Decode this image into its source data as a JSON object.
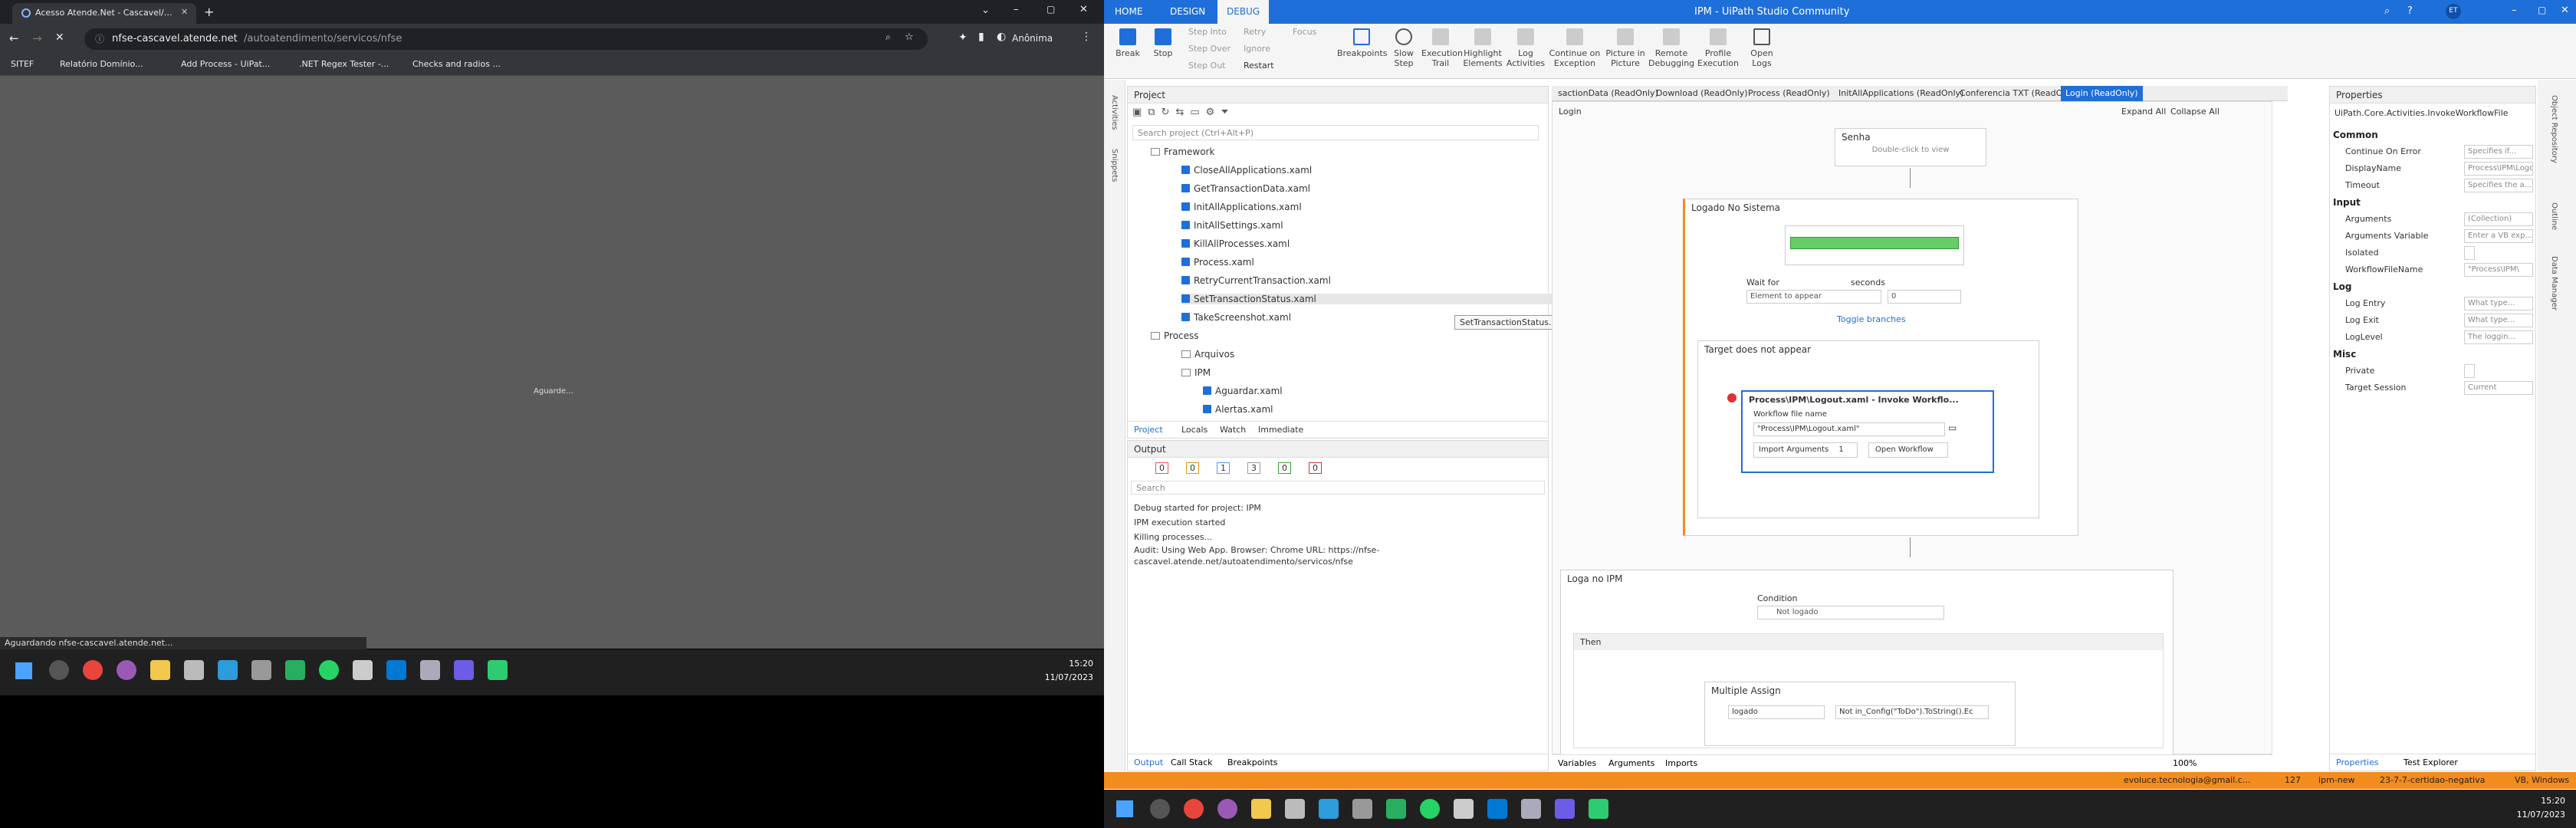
{
  "browser": {
    "tab_title": "Acesso Atende.Net - Cascavel/PR",
    "url_host": "nfse-cascavel.atende.net",
    "url_path": "/autoatendimento/servicos/nfse",
    "profile": "Anônima",
    "bookmarks": [
      "SITEF",
      "Relatório Domínio...",
      "Add Process - UiPat...",
      ".NET Regex Tester -...",
      "Checks and radios ..."
    ],
    "page_text": "Aguarde...",
    "status_text": "Aguardando nfse-cascavel.atende.net..."
  },
  "taskbar_left": {
    "time": "15:20",
    "date": "11/07/2023"
  },
  "studio": {
    "window_title": "IPM - UiPath Studio Community",
    "user_initials": "ET",
    "menu_tabs": [
      "HOME",
      "DESIGN",
      "DEBUG"
    ],
    "ribbon": {
      "break": "Break",
      "stop": "Stop",
      "step_into": "Step Into",
      "step_over": "Step Over",
      "step_out": "Step Out",
      "retry": "Retry",
      "ignore": "Ignore",
      "restart": "Restart",
      "focus": "Focus",
      "breakpoints": "Breakpoints",
      "slow_step": "Slow Step",
      "execution_trail": "Execution Trail",
      "highlight": "Highlight Elements",
      "log_activities": "Log Activities",
      "continue_on_exception": "Continue on Exception",
      "picture_in_picture": "Picture in Picture",
      "remote_debugging": "Remote Debugging",
      "profile_execution": "Profile Execution",
      "open_logs": "Open Logs"
    },
    "project": {
      "title": "Project",
      "search": "Search project (Ctrl+Alt+P)",
      "items": [
        "Framework",
        "CloseAllApplications.xaml",
        "GetTransactionData.xaml",
        "InitAllApplications.xaml",
        "InitAllSettings.xaml",
        "KillAllProcesses.xaml",
        "Process.xaml",
        "RetryCurrentTransaction.xaml",
        "SetTransactionStatus.xaml",
        "TakeScreenshot.xaml",
        "Process",
        "Arquivos",
        "IPM",
        "Aguardar.xaml",
        "Alertas.xaml"
      ],
      "tooltip": "SetTransactionStatus.xaml",
      "bottom_tabs": [
        "Project",
        "Locals",
        "Watch",
        "Immediate"
      ]
    },
    "output": {
      "title": "Output",
      "counts": [
        "0",
        "0",
        "1",
        "3",
        "0",
        "0"
      ],
      "search": "Search",
      "lines": [
        "Debug started for project: IPM",
        "IPM execution started",
        "Killing processes...",
        "Audit: Using Web App. Browser: Chrome URL: https://nfse-cascavel.atende.net/autoatendimento/servicos/nfse"
      ],
      "bottom_tabs": [
        "Output",
        "Call Stack",
        "Breakpoints"
      ]
    },
    "doc_tabs": [
      "sactionData (ReadOnly)",
      "Download (ReadOnly)",
      "Process (ReadOnly)",
      "InitAllApplications (ReadOnly)",
      "Conferencia TXT (ReadOnly)",
      "Login (ReadOnly)"
    ],
    "designer": {
      "breadcrumb": "Login",
      "expand_all": "Expand All",
      "collapse_all": "Collapse All",
      "senha_title": "Senha",
      "senha_hint": "Double-click to view",
      "logado_title": "Logado No Sistema",
      "wait_for": "Wait for",
      "wait_for_value": "Element to appear",
      "seconds": "seconds",
      "seconds_value": "0",
      "toggle_branches": "Toggle branches",
      "target_title": "Target does not appear",
      "invoke_title": "Process\\IPM\\Logout.xaml - Invoke Workflo...",
      "wf_file_label": "Workflow file name",
      "wf_file_value": "\"Process\\IPM\\Logout.xaml\"",
      "import_args": "Import Arguments",
      "import_count": "1",
      "open_workflow": "Open Workflow",
      "loga_title": "Loga no IPM",
      "condition_label": "Condition",
      "condition_value": "Not logado",
      "then_label": "Then",
      "multi_title": "Multiple Assign",
      "assign_to": "logado",
      "assign_value": "Not in_Config(\"ToDo\").ToString().Ec",
      "bottom_tabs": [
        "Variables",
        "Arguments",
        "Imports"
      ],
      "zoom": "100%"
    },
    "properties": {
      "title": "Properties",
      "type": "UiPath.Core.Activities.InvokeWorkflowFile",
      "cats": [
        "Common",
        "Input",
        "Log",
        "Misc"
      ],
      "rows": [
        {
          "k": "Continue On Error",
          "v": "Specifies if..."
        },
        {
          "k": "DisplayName",
          "v": "Process\\IPM\\Logou"
        },
        {
          "k": "Timeout",
          "v": "Specifies the a..."
        },
        {
          "k": "Arguments",
          "v": "(Collection)"
        },
        {
          "k": "Arguments Variable",
          "v": "Enter a VB exp..."
        },
        {
          "k": "Isolated",
          "v": ""
        },
        {
          "k": "WorkflowFileName",
          "v": "\"Process\\IPM\\"
        },
        {
          "k": "Log Entry",
          "v": "What type..."
        },
        {
          "k": "Log Exit",
          "v": "What type..."
        },
        {
          "k": "LogLevel",
          "v": "The loggin..."
        },
        {
          "k": "Private",
          "v": ""
        },
        {
          "k": "Target Session",
          "v": "Current"
        }
      ],
      "bottom_tabs": [
        "Properties",
        "Test Explorer"
      ]
    },
    "status": {
      "email": "evoluce.tecnologia@gmail.c...",
      "count": "127",
      "branch": "ipm-new",
      "task": "23-7-7-certidao-negativa",
      "env": "VB, Windows"
    }
  },
  "taskbar_right": {
    "time": "15:20",
    "date": "11/07/2023"
  }
}
